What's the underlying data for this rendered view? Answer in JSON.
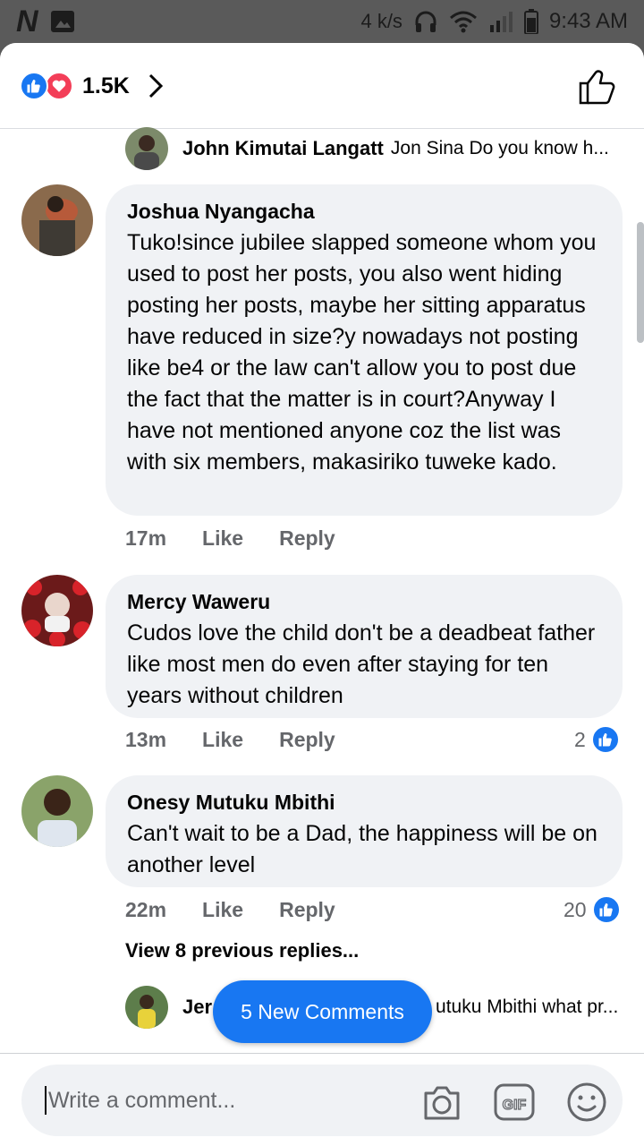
{
  "status_bar": {
    "speed": "4 k/s",
    "time": "9:43 AM"
  },
  "header": {
    "reaction_count": "1.5K"
  },
  "top_reply": {
    "author": "John Kimutai Langatt",
    "snippet": "Jon Sina Do you know h..."
  },
  "comments": [
    {
      "author": "Joshua Nyangacha",
      "text": "Tuko!since jubilee slapped someone whom you used to post her posts, you also went hiding posting her posts, maybe her sitting apparatus have reduced in size?y nowadays not posting like be4  or the law can't allow you to post due the fact that the matter is in court?Anyway I have not mentioned anyone coz the list was with six members, makasiriko tuweke kado.",
      "time": "17m",
      "like_label": "Like",
      "reply_label": "Reply"
    },
    {
      "author": "Mercy Waweru",
      "text": "Cudos love the child don't be a deadbeat father like most men do even after staying for ten years without children",
      "time": "13m",
      "like_label": "Like",
      "reply_label": "Reply",
      "likes": "2"
    },
    {
      "author": "Onesy Mutuku Mbithi",
      "text": "Can't wait to be a Dad, the happiness will be on another level",
      "time": "22m",
      "like_label": "Like",
      "reply_label": "Reply",
      "likes": "20"
    }
  ],
  "view_previous": "View 8 previous replies...",
  "bottom_reply": {
    "author": "Jer",
    "snippet": "utuku Mbithi what pr..."
  },
  "new_comments_button": "5 New Comments",
  "composer": {
    "placeholder": "Write a comment..."
  },
  "icons": {
    "like_reaction": "like-reaction-icon",
    "love_reaction": "love-reaction-icon",
    "camera": "camera-icon",
    "gif": "gif-icon",
    "sticker": "smiley-icon",
    "thumbs_up": "thumbs-up-icon"
  },
  "colors": {
    "brand_blue": "#1877f2",
    "love_red": "#f33e58",
    "bubble_bg": "#f0f2f5",
    "secondary_text": "#65676b"
  }
}
